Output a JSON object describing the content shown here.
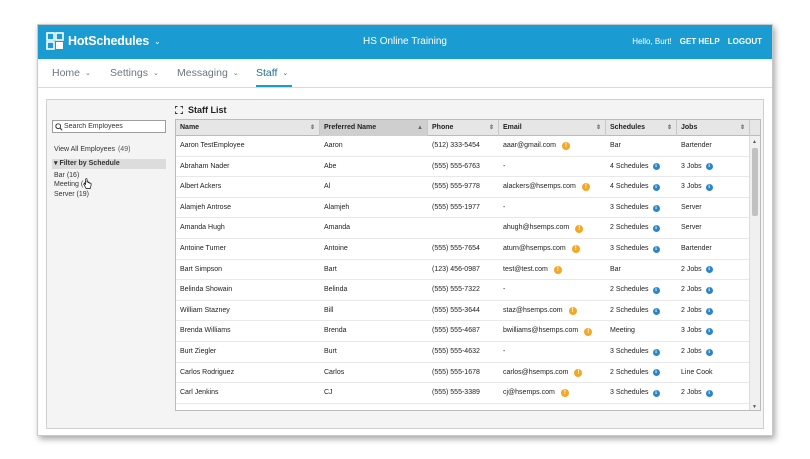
{
  "app": {
    "logo_text": "HotSchedules",
    "title": "HS Online Training",
    "greeting": "Hello, Burt!",
    "get_help": "GET HELP",
    "logout": "LOGOUT"
  },
  "nav": {
    "items": [
      {
        "label": "Home"
      },
      {
        "label": "Settings"
      },
      {
        "label": "Messaging"
      },
      {
        "label": "Staff"
      }
    ],
    "active": "Staff"
  },
  "sidebar": {
    "search_placeholder": "Search Employees",
    "view_all_label": "View All Employees",
    "view_all_count": "(49)",
    "filter_header": "▾ Filter by Schedule",
    "filters": [
      {
        "label": "Bar (16)"
      },
      {
        "label": "Meeting (4)"
      },
      {
        "label": "Server (19)"
      }
    ]
  },
  "staff_list": {
    "title": "Staff List",
    "columns": [
      "Name",
      "Preferred Name",
      "Phone",
      "Email",
      "Schedules",
      "Jobs"
    ],
    "sorted_column": "Preferred Name",
    "rows": [
      {
        "name": "Aaron TestEmployee",
        "preferred": "Aaron",
        "phone": "(512) 333-5454",
        "email": "aaar@gmail.com",
        "email_warn": true,
        "schedules": "Bar",
        "schedules_info": false,
        "jobs": "Bartender",
        "jobs_info": false
      },
      {
        "name": "Abraham Nader",
        "preferred": "Abe",
        "phone": "(555) 555-6763",
        "email": "-",
        "email_warn": false,
        "schedules": "4 Schedules",
        "schedules_info": true,
        "jobs": "3 Jobs",
        "jobs_info": true
      },
      {
        "name": "Albert Ackers",
        "preferred": "Al",
        "phone": "(555) 555-9778",
        "email": "alackers@hsemps.com",
        "email_warn": true,
        "schedules": "4 Schedules",
        "schedules_info": true,
        "jobs": "3 Jobs",
        "jobs_info": true
      },
      {
        "name": "Alamjeh Antrose",
        "preferred": "Alamjeh",
        "phone": "(555) 555-1977",
        "email": "-",
        "email_warn": false,
        "schedules": "3 Schedules",
        "schedules_info": true,
        "jobs": "Server",
        "jobs_info": false
      },
      {
        "name": "Amanda Hugh",
        "preferred": "Amanda",
        "phone": "",
        "email": "ahugh@hsemps.com",
        "email_warn": true,
        "schedules": "2 Schedules",
        "schedules_info": true,
        "jobs": "Server",
        "jobs_info": false
      },
      {
        "name": "Antoine Turner",
        "preferred": "Antoine",
        "phone": "(555) 555-7654",
        "email": "aturn@hsemps.com",
        "email_warn": true,
        "schedules": "3 Schedules",
        "schedules_info": true,
        "jobs": "Bartender",
        "jobs_info": false
      },
      {
        "name": "Bart Simpson",
        "preferred": "Bart",
        "phone": "(123) 456-0987",
        "email": "test@test.com",
        "email_warn": true,
        "schedules": "Bar",
        "schedules_info": false,
        "jobs": "2 Jobs",
        "jobs_info": true
      },
      {
        "name": "Belinda Showain",
        "preferred": "Belinda",
        "phone": "(555) 555-7322",
        "email": "-",
        "email_warn": false,
        "schedules": "2 Schedules",
        "schedules_info": true,
        "jobs": "2 Jobs",
        "jobs_info": true
      },
      {
        "name": "William Stazney",
        "preferred": "Bill",
        "phone": "(555) 555-3644",
        "email": "staz@hsemps.com",
        "email_warn": true,
        "schedules": "2 Schedules",
        "schedules_info": true,
        "jobs": "2 Jobs",
        "jobs_info": true
      },
      {
        "name": "Brenda Williams",
        "preferred": "Brenda",
        "phone": "(555) 555-4687",
        "email": "bwilliams@hsemps.com",
        "email_warn": true,
        "schedules": "Meeting",
        "schedules_info": false,
        "jobs": "3 Jobs",
        "jobs_info": true
      },
      {
        "name": "Burt Ziegler",
        "preferred": "Burt",
        "phone": "(555) 555-4632",
        "email": "-",
        "email_warn": false,
        "schedules": "3 Schedules",
        "schedules_info": true,
        "jobs": "2 Jobs",
        "jobs_info": true
      },
      {
        "name": "Carlos Rodriguez",
        "preferred": "Carlos",
        "phone": "(555) 555-1678",
        "email": "carlos@hsemps.com",
        "email_warn": true,
        "schedules": "2 Schedules",
        "schedules_info": true,
        "jobs": "Line Cook",
        "jobs_info": false
      },
      {
        "name": "Carl Jenkins",
        "preferred": "CJ",
        "phone": "(555) 555-3389",
        "email": "cj@hsemps.com",
        "email_warn": true,
        "schedules": "3 Schedules",
        "schedules_info": true,
        "jobs": "2 Jobs",
        "jobs_info": true
      }
    ]
  },
  "colors": {
    "brand_blue": "#1a9cd3",
    "warn_orange": "#f5a623",
    "info_blue": "#2a86c7"
  }
}
